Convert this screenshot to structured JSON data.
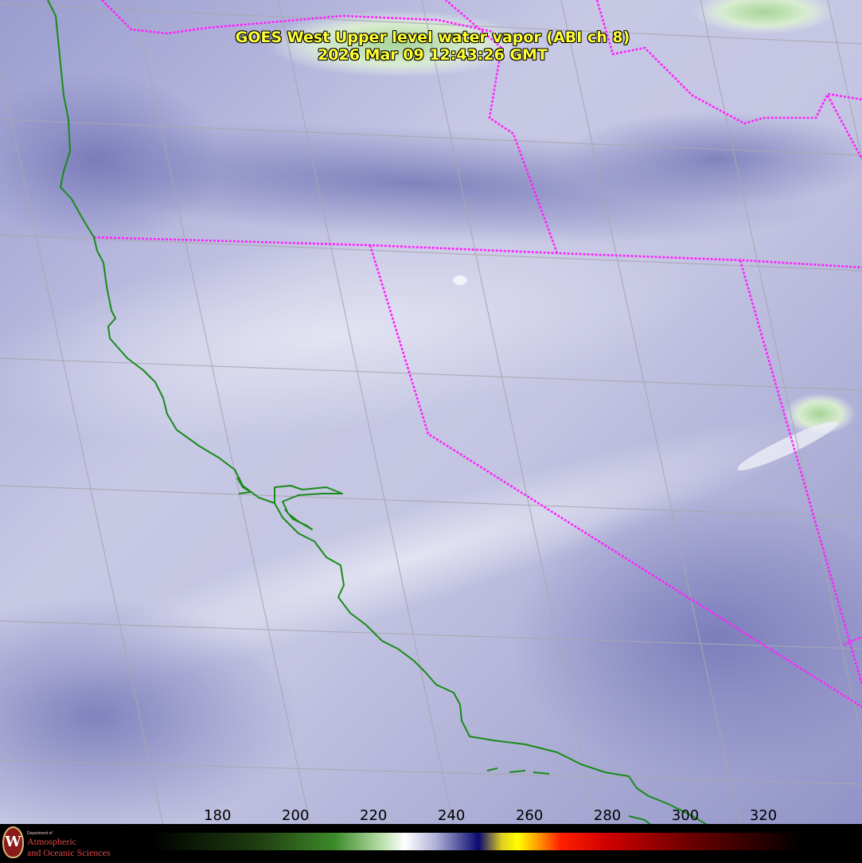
{
  "title": {
    "line1": "GOES West Upper level water vapor (ABI ch 8)",
    "line2": "2026 Mar 09  12:43:26 GMT"
  },
  "logo": {
    "dept": "Department of",
    "line1": "Atmospheric",
    "line2": "and Oceanic Sciences",
    "seal_letter": "W"
  },
  "colorbar": {
    "ticks": [
      "180",
      "200",
      "220",
      "240",
      "260",
      "280",
      "300",
      "320"
    ],
    "tick_values": [
      180,
      200,
      220,
      240,
      260,
      280,
      300,
      320
    ],
    "range": [
      163,
      330
    ],
    "stops": [
      {
        "v": 163,
        "c": "#000000"
      },
      {
        "v": 190,
        "c": "#1e3d10"
      },
      {
        "v": 210,
        "c": "#3d8a2a"
      },
      {
        "v": 222,
        "c": "#b8dfa8"
      },
      {
        "v": 228,
        "c": "#ffffff"
      },
      {
        "v": 236,
        "c": "#b0b0d8"
      },
      {
        "v": 247,
        "c": "#0a0a70"
      },
      {
        "v": 253,
        "c": "#e0d020"
      },
      {
        "v": 257,
        "c": "#ffff00"
      },
      {
        "v": 262,
        "c": "#ffa000"
      },
      {
        "v": 268,
        "c": "#ff2000"
      },
      {
        "v": 280,
        "c": "#d00000"
      },
      {
        "v": 300,
        "c": "#700000"
      },
      {
        "v": 330,
        "c": "#000000"
      }
    ]
  },
  "colors": {
    "border": "#ff22ff",
    "coast": "#1a8a1a",
    "grid": "#a8a8b0",
    "title": "#ffff33"
  }
}
